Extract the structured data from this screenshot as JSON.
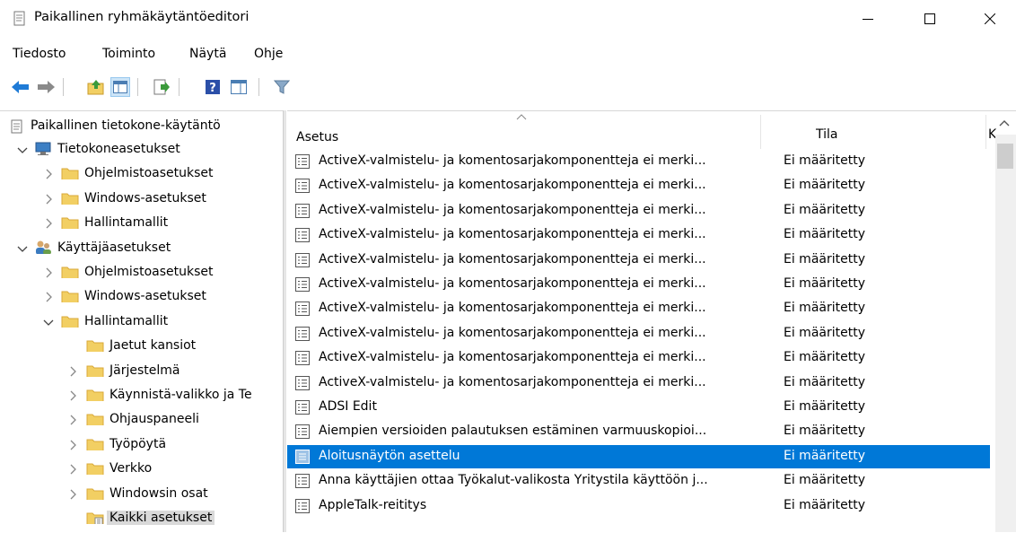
{
  "window": {
    "title": "Paikallinen ryhmäkäytäntöeditori",
    "controls": {
      "minimize": "—",
      "maximize": "☐",
      "close": "✕"
    }
  },
  "menu": [
    "Tiedosto",
    "Toiminto",
    "Näytä",
    "Ohje"
  ],
  "toolbar": [
    "back-icon",
    "forward-icon",
    "up-folder-icon",
    "show-hide-tree-icon",
    "export-list-icon",
    "help-icon",
    "extended-view-icon",
    "filter-icon"
  ],
  "tree": {
    "root": "Paikallinen tietokone-käytäntö",
    "nodes": [
      {
        "label": "Tietokoneasetukset",
        "depth": 1,
        "expanded": true,
        "icon": "computer-icon"
      },
      {
        "label": "Ohjelmistoasetukset",
        "depth": 2,
        "expanded": false,
        "icon": "folder-icon"
      },
      {
        "label": "Windows-asetukset",
        "depth": 2,
        "expanded": false,
        "icon": "folder-icon"
      },
      {
        "label": "Hallintamallit",
        "depth": 2,
        "expanded": false,
        "icon": "folder-icon"
      },
      {
        "label": "Käyttäjäasetukset",
        "depth": 1,
        "expanded": true,
        "icon": "users-icon"
      },
      {
        "label": "Ohjelmistoasetukset",
        "depth": 2,
        "expanded": false,
        "icon": "folder-icon"
      },
      {
        "label": "Windows-asetukset",
        "depth": 2,
        "expanded": false,
        "icon": "folder-icon"
      },
      {
        "label": "Hallintamallit",
        "depth": 2,
        "expanded": true,
        "icon": "folder-icon"
      },
      {
        "label": "Jaetut kansiot",
        "depth": 3,
        "expanded": null,
        "icon": "folder-icon"
      },
      {
        "label": "Järjestelmä",
        "depth": 3,
        "expanded": false,
        "icon": "folder-icon"
      },
      {
        "label": "Käynnistä-valikko ja Te",
        "depth": 3,
        "expanded": false,
        "icon": "folder-icon"
      },
      {
        "label": "Ohjauspaneeli",
        "depth": 3,
        "expanded": false,
        "icon": "folder-icon"
      },
      {
        "label": "Työpöytä",
        "depth": 3,
        "expanded": false,
        "icon": "folder-icon"
      },
      {
        "label": "Verkko",
        "depth": 3,
        "expanded": false,
        "icon": "folder-icon"
      },
      {
        "label": "Windowsin osat",
        "depth": 3,
        "expanded": false,
        "icon": "folder-icon"
      },
      {
        "label": "Kaikki asetukset",
        "depth": 3,
        "expanded": null,
        "icon": "all-settings-icon",
        "selected": true
      }
    ]
  },
  "list": {
    "columns": [
      "Asetus",
      "Tila",
      "K"
    ],
    "rows": [
      {
        "name": "ActiveX-valmistelu- ja komentosarjakomponentteja ei merki...",
        "state": "Ei määritetty"
      },
      {
        "name": "ActiveX-valmistelu- ja komentosarjakomponentteja ei merki...",
        "state": "Ei määritetty"
      },
      {
        "name": "ActiveX-valmistelu- ja komentosarjakomponentteja ei merki...",
        "state": "Ei määritetty"
      },
      {
        "name": "ActiveX-valmistelu- ja komentosarjakomponentteja ei merki...",
        "state": "Ei määritetty"
      },
      {
        "name": "ActiveX-valmistelu- ja komentosarjakomponentteja ei merki...",
        "state": "Ei määritetty"
      },
      {
        "name": "ActiveX-valmistelu- ja komentosarjakomponentteja ei merki...",
        "state": "Ei määritetty"
      },
      {
        "name": "ActiveX-valmistelu- ja komentosarjakomponentteja ei merki...",
        "state": "Ei määritetty"
      },
      {
        "name": "ActiveX-valmistelu- ja komentosarjakomponentteja ei merki...",
        "state": "Ei määritetty"
      },
      {
        "name": "ActiveX-valmistelu- ja komentosarjakomponentteja ei merki...",
        "state": "Ei määritetty"
      },
      {
        "name": "ActiveX-valmistelu- ja komentosarjakomponentteja ei merki...",
        "state": "Ei määritetty"
      },
      {
        "name": "ADSI Edit",
        "state": "Ei määritetty"
      },
      {
        "name": "Aiempien versioiden palautuksen estäminen varmuuskopioi...",
        "state": "Ei määritetty"
      },
      {
        "name": "Aloitusnäytön asettelu",
        "state": "Ei määritetty",
        "selected": true
      },
      {
        "name": "Anna käyttäjien ottaa Työkalut-valikosta Yritystila käyttöön j...",
        "state": "Ei määritetty"
      },
      {
        "name": "AppleTalk-reititys",
        "state": "Ei määritetty"
      }
    ]
  },
  "colors": {
    "selection": "#0078d7",
    "folder": "#f2cf63",
    "folder_edge": "#d9a93a"
  }
}
